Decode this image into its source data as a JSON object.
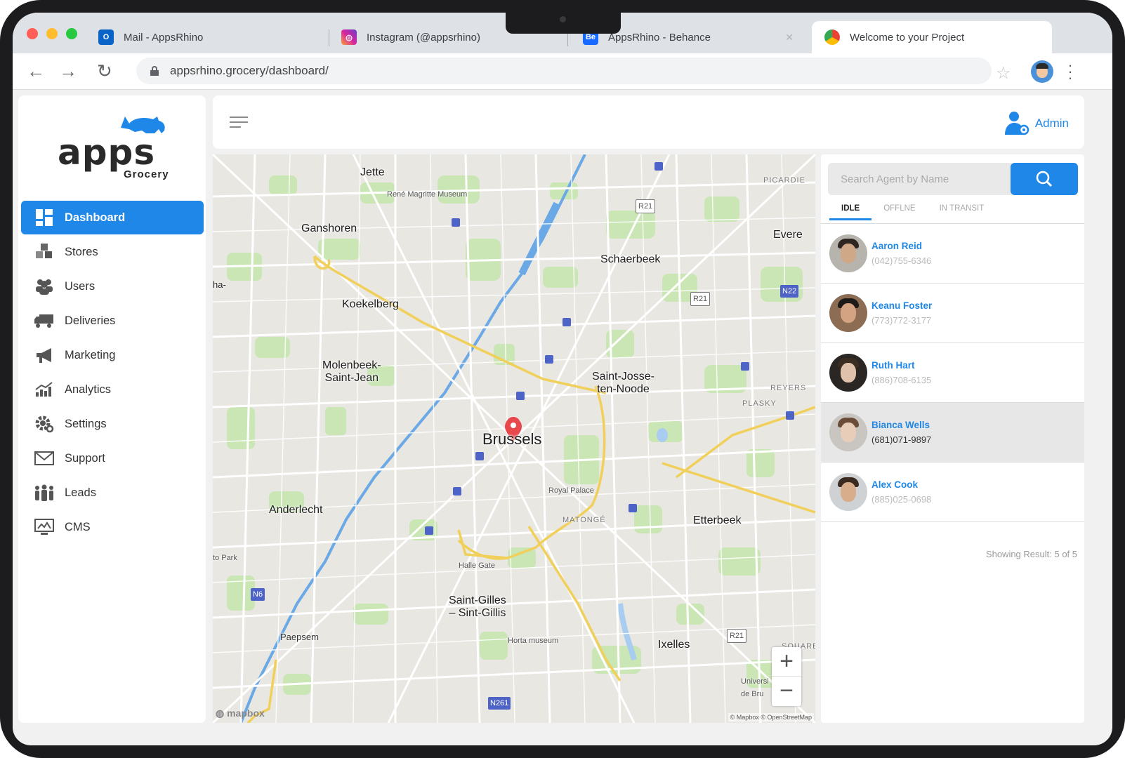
{
  "browser": {
    "tabs": [
      {
        "label": "Mail - AppsRhino",
        "icon": "outlook-icon"
      },
      {
        "label": "Instagram (@appsrhino)",
        "icon": "instagram-icon"
      },
      {
        "label": "AppsRhino - Behance",
        "icon": "behance-icon"
      },
      {
        "label": "Welcome to your Project",
        "icon": "chrome-icon"
      }
    ],
    "url": "appsrhino.grocery/dashboard/"
  },
  "brand": {
    "name": "apps",
    "sub": "Grocery",
    "accent": "#1f87e8"
  },
  "sidebar": {
    "items": [
      {
        "label": "Dashboard",
        "icon": "dashboard-icon",
        "active": true
      },
      {
        "label": "Stores",
        "icon": "stores-icon"
      },
      {
        "label": "Users",
        "icon": "users-icon"
      },
      {
        "label": "Deliveries",
        "icon": "truck-icon"
      },
      {
        "label": "Marketing",
        "icon": "megaphone-icon"
      },
      {
        "label": "Analytics",
        "icon": "analytics-icon"
      },
      {
        "label": "Settings",
        "icon": "gear-icon"
      },
      {
        "label": "Support",
        "icon": "mail-icon"
      },
      {
        "label": "Leads",
        "icon": "leads-icon"
      },
      {
        "label": "CMS",
        "icon": "cms-icon"
      }
    ]
  },
  "header": {
    "user_label": "Admin"
  },
  "map": {
    "labels": {
      "jette": "Jette",
      "magritte": "René Magritte Museum",
      "picardie": "PICARDIE",
      "ganshoren": "Ganshoren",
      "evere": "Evere",
      "schaerbeek": "Schaerbeek",
      "koekelberg": "Koekelberg",
      "molenbeek": "Molenbeek-\nSaint-Jean",
      "saintjosse": "Saint-Josse-\nten-Noode",
      "reyers": "REYERS",
      "plasky": "PLASKY",
      "brussels": "Brussels",
      "royalpalace": "Royal Palace",
      "anderlecht": "Anderlecht",
      "matonge": "MATONGÉ",
      "etterbeek": "Etterbeek",
      "hallegate": "Halle Gate",
      "saintgilles": "Saint-Gilles\n– Sint-Gillis",
      "paepsem": "Paepsem",
      "horta": "Horta museum",
      "ixelles": "Ixelles",
      "square": "SQUARE",
      "univ": "Universi\nde Bru",
      "topark": "to Park",
      "ha": "ha-"
    },
    "road_signs": {
      "r21a": "R21",
      "r21b": "R21",
      "r21c": "R21",
      "n22": "N22",
      "n6": "N6",
      "n261": "N261"
    },
    "zoom_in": "+",
    "zoom_out": "−",
    "logo": "mapbox",
    "attribution": "© Mapbox © OpenStreetMap"
  },
  "agents_panel": {
    "search_placeholder": "Search Agent by Name",
    "tabs": [
      "IDLE",
      "OFFLNE",
      "IN TRANSIT"
    ],
    "agents": [
      {
        "name": "Aaron Reid",
        "phone": "(042)755-6346"
      },
      {
        "name": "Keanu Foster",
        "phone": "(773)772-3177"
      },
      {
        "name": "Ruth Hart",
        "phone": "(886)708-6135"
      },
      {
        "name": "Bianca Wells",
        "phone": "(681)071-9897",
        "selected": true
      },
      {
        "name": "Alex Cook",
        "phone": "(885)025-0698"
      }
    ],
    "showing": "Showing Result: 5 of 5"
  }
}
